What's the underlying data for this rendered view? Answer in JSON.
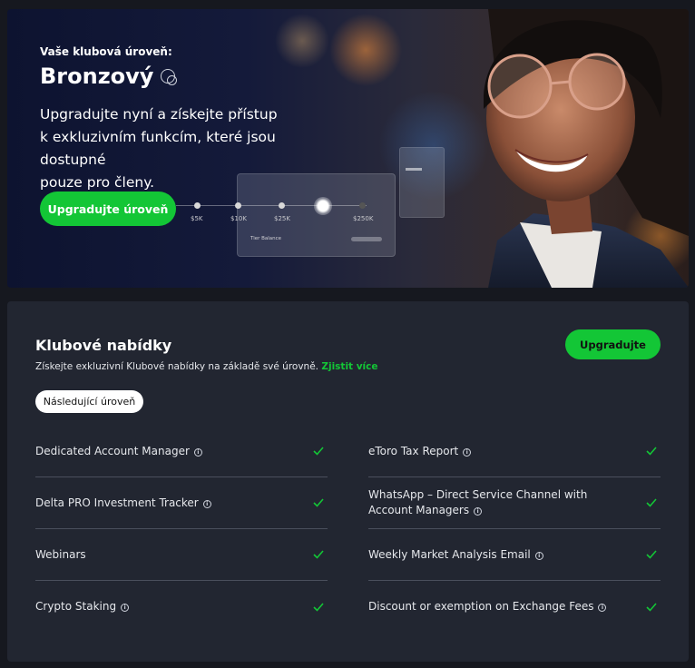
{
  "hero": {
    "eyebrow": "Vaše klubová úroveň:",
    "tier": "Bronzový",
    "tier_icon": "tier-circles-icon",
    "subtitle_lines": [
      "Upgradujte nyní a získejte přístup",
      "k exkluzivním funkcím, které jsou dostupné",
      "pouze pro členy."
    ],
    "cta_label": "Upgradujte úroveň",
    "progress_labels": [
      "$5K",
      "$10K",
      "$25K",
      "$250K"
    ],
    "card_caption": "Tier Balance"
  },
  "club": {
    "title": "Klubové nabídky",
    "description": "Získejte exkluzivní Klubové nabídky na základě své úrovně.",
    "learn_more": "Zjistit více",
    "next_level_label": "Následující úroveň",
    "upgrade_label": "Upgradujte",
    "left_items": [
      "Dedicated Account Manager",
      "Delta PRO Investment Tracker",
      "Webinars",
      "Crypto Staking"
    ],
    "right_items": [
      "eToro Tax Report",
      "WhatsApp – Direct Service Channel with Account Managers",
      "Weekly Market Analysis Email",
      "Discount or exemption on Exchange Fees"
    ]
  },
  "colors": {
    "accent_green": "#13c636",
    "panel_bg": "#222631",
    "page_bg": "#16181f"
  }
}
